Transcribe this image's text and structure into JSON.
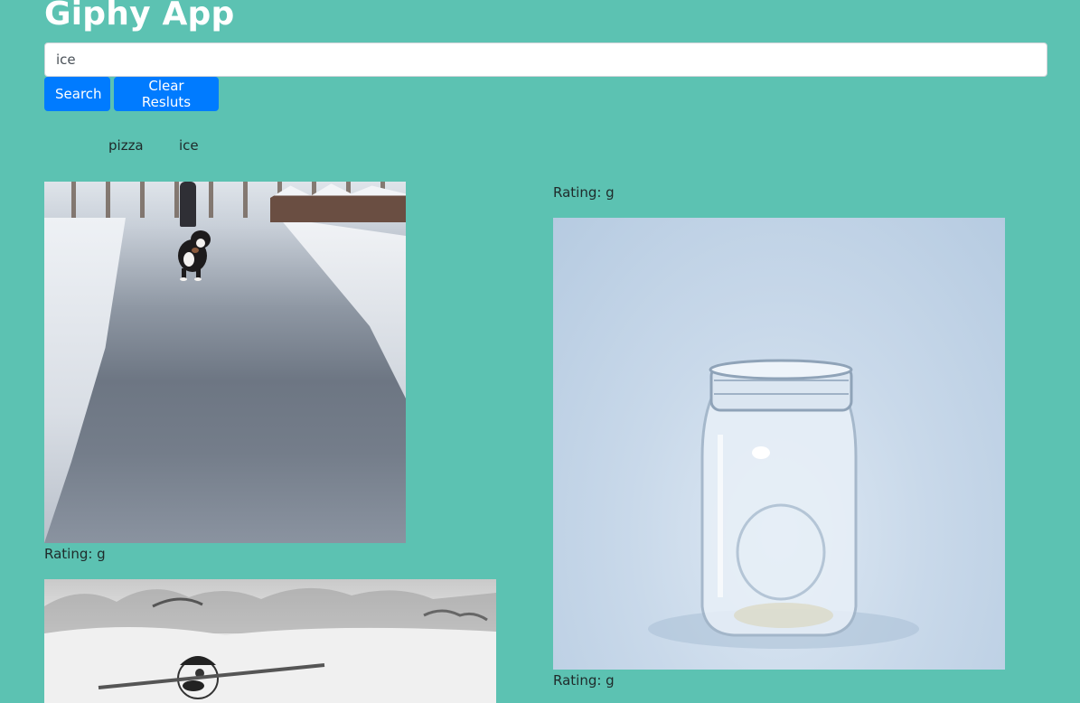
{
  "app": {
    "title": "Giphy App"
  },
  "search": {
    "value": "ice",
    "search_label": "Search",
    "clear_label": "Clear Resluts"
  },
  "history": [
    "pizza",
    "ice"
  ],
  "results": [
    {
      "rating": "Rating: g"
    },
    {
      "rating": "Rating: g"
    },
    {
      "rating": "Rating: g"
    }
  ],
  "colors": {
    "background": "#5cc2b2",
    "button": "#007bff",
    "title": "#ffffff"
  }
}
